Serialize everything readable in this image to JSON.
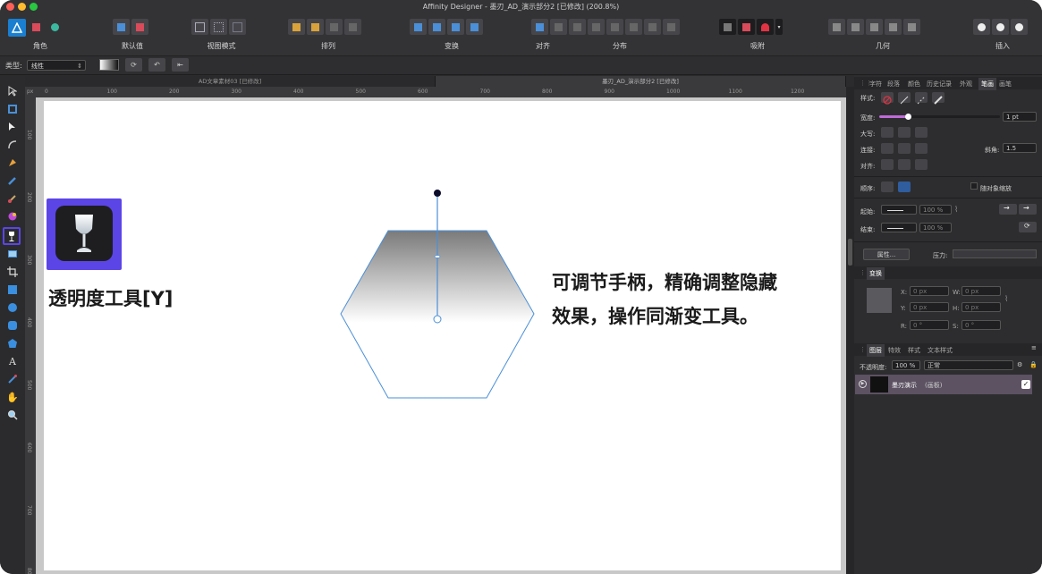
{
  "window": {
    "title": "Affinity Designer - 墨刃_AD_演示部分2 [已修改] (200.8%)"
  },
  "toolbar": {
    "groups": [
      {
        "label": "角色"
      },
      {
        "label": "默认值"
      },
      {
        "label": "视图模式"
      },
      {
        "label": "排列"
      },
      {
        "label": "变换"
      },
      {
        "label": "对齐"
      },
      {
        "label": "分布"
      },
      {
        "label": "吸附"
      },
      {
        "label": "几何"
      },
      {
        "label": "插入"
      }
    ]
  },
  "context": {
    "type_label": "类型:",
    "type_value": "线性"
  },
  "doc_tabs": [
    "AD文章素材03 [已修改]",
    "墨刃_AD_演示部分2 [已修改]"
  ],
  "ruler": {
    "unit": "px",
    "h_ticks": [
      "0",
      "100",
      "200",
      "300",
      "400",
      "500",
      "600",
      "700",
      "800",
      "900",
      "1000",
      "1100",
      "1200"
    ],
    "v_ticks": [
      "100",
      "200",
      "300",
      "400",
      "500",
      "600",
      "700",
      "800"
    ]
  },
  "canvas": {
    "tool_label": "透明度工具[Y]",
    "desc_line1": "可调节手柄，精确调整隐藏",
    "desc_line2": "效果，操作同渐变工具。"
  },
  "panel": {
    "tabs": [
      "字符",
      "段落",
      "颜色",
      "历史记录",
      "外观",
      "笔画",
      "画笔"
    ],
    "active_tab": "笔画",
    "style_label": "样式:",
    "width_label": "宽度:",
    "width_value": "1 pt",
    "cap_label": "大写:",
    "join_label": "连接:",
    "miter_label": "斜角:",
    "miter_value": "1.5",
    "align_label": "对齐:",
    "order_label": "顺序:",
    "scale_label": "随对象缩放",
    "start_label": "起始:",
    "start_pct": "100 %",
    "end_label": "结束:",
    "end_pct": "100 %",
    "props_button": "属性...",
    "pressure_label": "压力:",
    "transform_tab": "变换",
    "x_label": "X:",
    "x_value": "0 px",
    "y_label": "Y:",
    "y_value": "0 px",
    "w_label": "W:",
    "w_value": "0 px",
    "h_label": "H:",
    "h_value": "0 px",
    "r_label": "R:",
    "r_value": "0 °",
    "s_label": "S:",
    "s_value": "0 °",
    "layers_tabs": [
      "图层",
      "特效",
      "样式",
      "文本样式"
    ],
    "opacity_label": "不透明度:",
    "opacity_value": "100 %",
    "blend_value": "正常",
    "layer_name": "墨刃演示",
    "layer_type": "(画板)"
  },
  "colors": {
    "accent": "#5b45e6",
    "handle": "#4a8fd8",
    "layer_row": "#5c5262"
  }
}
